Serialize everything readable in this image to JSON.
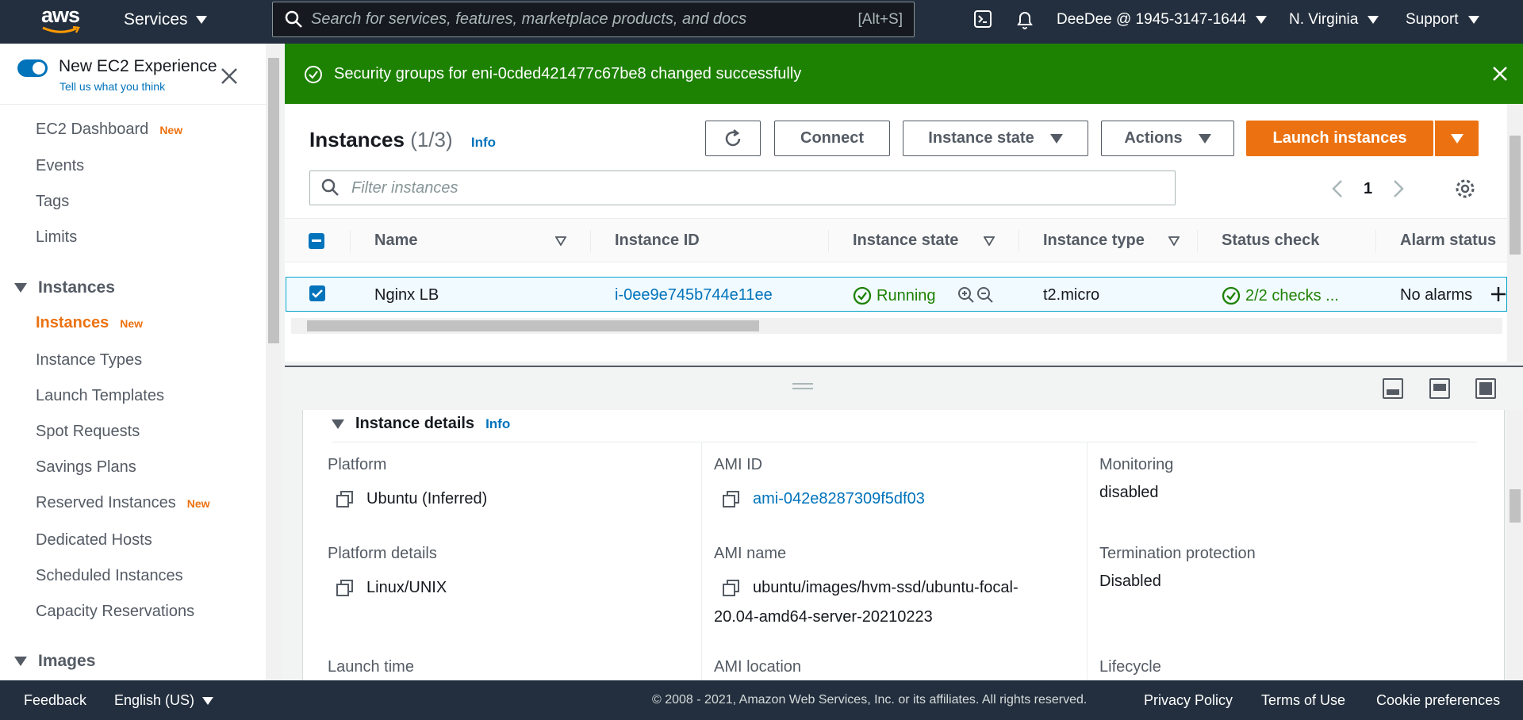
{
  "nav": {
    "logo": "aws",
    "services": "Services",
    "search_placeholder": "Search for services, features, marketplace products, and docs",
    "search_hint": "[Alt+S]",
    "account": "DeeDee @ 1945-3147-1644",
    "region": "N. Virginia",
    "support": "Support"
  },
  "sidebar": {
    "experience_title": "New EC2 Experience",
    "experience_link": "Tell us what you think",
    "dashboard": "EC2 Dashboard",
    "new_badge": "New",
    "events": "Events",
    "tags": "Tags",
    "limits": "Limits",
    "section_instances": "Instances",
    "items": [
      "Instances",
      "Instance Types",
      "Launch Templates",
      "Spot Requests",
      "Savings Plans",
      "Reserved Instances",
      "Dedicated Hosts",
      "Scheduled Instances",
      "Capacity Reservations"
    ],
    "section_images": "Images"
  },
  "flash": {
    "message": "Security groups for eni-0cded421477c67be8 changed successfully"
  },
  "instances": {
    "title": "Instances",
    "count": "(1/3)",
    "info": "Info",
    "connect": "Connect",
    "instance_state": "Instance state",
    "actions": "Actions",
    "launch": "Launch instances",
    "filter_placeholder": "Filter instances",
    "page": "1",
    "columns": [
      "Name",
      "Instance ID",
      "Instance state",
      "Instance type",
      "Status check",
      "Alarm status"
    ],
    "row": {
      "name": "Nginx LB",
      "id": "i-0ee9e745b744e11ee",
      "state": "Running",
      "type": "t2.micro",
      "status": "2/2 checks ...",
      "alarm": "No alarms"
    }
  },
  "details": {
    "title": "Instance details",
    "info": "Info",
    "platform_label": "Platform",
    "platform_value": "Ubuntu (Inferred)",
    "ami_id_label": "AMI ID",
    "ami_id_value": "ami-042e8287309f5df03",
    "monitoring_label": "Monitoring",
    "monitoring_value": "disabled",
    "platform_details_label": "Platform details",
    "platform_details_value": "Linux/UNIX",
    "ami_name_label": "AMI name",
    "ami_name_line1": "ubuntu/images/hvm-ssd/ubuntu-focal-",
    "ami_name_line2": "20.04-amd64-server-20210223",
    "termination_label": "Termination protection",
    "termination_value": "Disabled",
    "launch_time_label": "Launch time",
    "ami_location_label": "AMI location",
    "lifecycle_label": "Lifecycle"
  },
  "footer": {
    "feedback": "Feedback",
    "language": "English (US)",
    "copyright": "© 2008 - 2021, Amazon Web Services, Inc. or its affiliates. All rights reserved.",
    "privacy": "Privacy Policy",
    "terms": "Terms of Use",
    "cookies": "Cookie preferences"
  },
  "colors": {
    "nav_bg": "#232f3e",
    "success": "#1d8102",
    "accent": "#ec7211",
    "link": "#0073bb"
  }
}
